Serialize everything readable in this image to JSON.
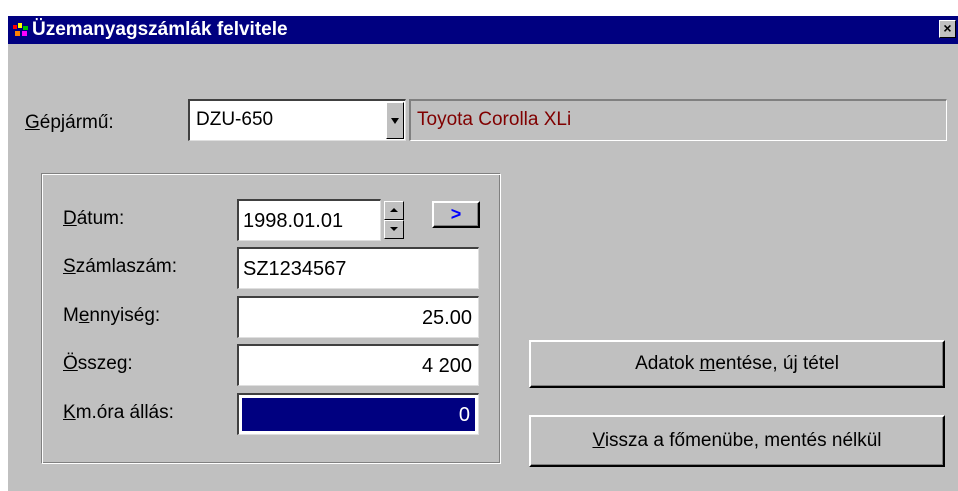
{
  "window": {
    "title": "Üzemanyagszámlák felvitele",
    "close_glyph": "×",
    "icon": "app-icon"
  },
  "vehicle": {
    "label_prefix": "",
    "label_accel": "G",
    "label_rest": "épjármű:",
    "selected": "DZU-650",
    "description": "Toyota  Corolla XLi",
    "description_color": "#800000"
  },
  "form": {
    "date": {
      "label_accel": "D",
      "label_rest": "átum:",
      "value": "1998.01.01",
      "next_label": ">"
    },
    "invoice": {
      "label_accel": "S",
      "label_rest": "zámlaszám:",
      "value": "SZ1234567"
    },
    "quantity": {
      "label_pre": "M",
      "label_accel": "e",
      "label_rest": "nnyiség:",
      "value": "25.00"
    },
    "amount": {
      "label_accel": "Ö",
      "label_rest": "sszeg:",
      "value": "4 200"
    },
    "odometer": {
      "label_accel": "K",
      "label_rest": "m.óra állás:",
      "value": "0"
    }
  },
  "buttons": {
    "save": {
      "pre": "Adatok ",
      "accel": "m",
      "post": "entése, új tétel"
    },
    "back": {
      "pre": "",
      "accel": "V",
      "post": "issza a főmenübe, mentés nélkül"
    }
  },
  "colors": {
    "titlebar": "#000080",
    "face": "#c0c0c0",
    "accent_blue": "#0000ff",
    "selection": "#000080"
  }
}
